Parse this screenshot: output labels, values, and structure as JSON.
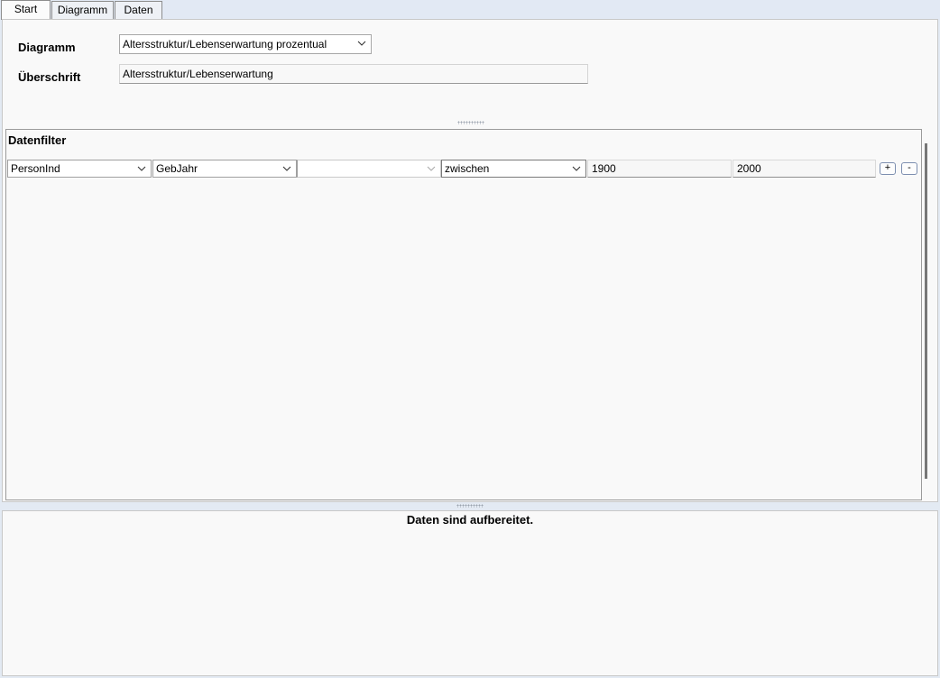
{
  "tabs": [
    {
      "label": "Start",
      "active": true
    },
    {
      "label": "Diagramm",
      "active": false
    },
    {
      "label": "Daten",
      "active": false
    }
  ],
  "settings": {
    "diagram_label": "Diagramm",
    "diagram_value": "Altersstruktur/Lebenserwartung prozentual",
    "heading_label": "Überschrift",
    "heading_value": "Altersstruktur/Lebenserwartung"
  },
  "filter": {
    "title": "Datenfilter",
    "row": {
      "table": "PersonInd",
      "field": "GebJahr",
      "third": "",
      "operator": "zwischen",
      "from": "1900",
      "to": "2000",
      "add_label": "+",
      "remove_label": "-"
    }
  },
  "status": {
    "message": "Daten sind aufbereitet."
  },
  "icons": {
    "dropdown": "chevron-down-icon",
    "splitter": "grip-dots-icon"
  },
  "colors": {
    "background": "#e3eaf3",
    "panel": "#f9f9f9",
    "button_border": "#7d8fb0"
  }
}
